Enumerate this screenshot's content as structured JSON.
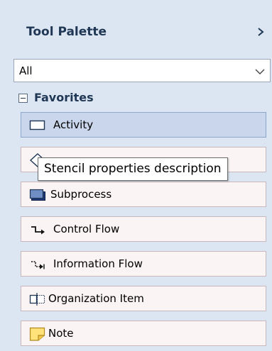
{
  "palette": {
    "title": "Tool Palette",
    "expand_icon": "chevron-right-icon"
  },
  "filter": {
    "selected": "All",
    "dropdown_icon": "chevron-down-icon"
  },
  "group": {
    "label": "Favorites",
    "collapse_icon": "minus-box-icon",
    "items": [
      {
        "label": "Activity",
        "icon": "activity-rectangle-icon",
        "selected": true
      },
      {
        "label": "",
        "icon": "decision-diamond-icon",
        "selected": false
      },
      {
        "label": "Subprocess",
        "icon": "subprocess-icon",
        "selected": false
      },
      {
        "label": "Control Flow",
        "icon": "control-flow-arrow-icon",
        "selected": false
      },
      {
        "label": "Information Flow",
        "icon": "information-flow-arrow-icon",
        "selected": false
      },
      {
        "label": "Organization Item",
        "icon": "organization-item-icon",
        "selected": false
      },
      {
        "label": "Note",
        "icon": "note-icon",
        "selected": false
      }
    ]
  },
  "tooltip": {
    "text": "Stencil properties description"
  },
  "colors": {
    "panel_background": "#dce6f2",
    "title_text": "#1f3654",
    "item_background": "#fbf4f4",
    "selected_background": "#c9d6ec",
    "note_yellow": "#ffe27a"
  }
}
